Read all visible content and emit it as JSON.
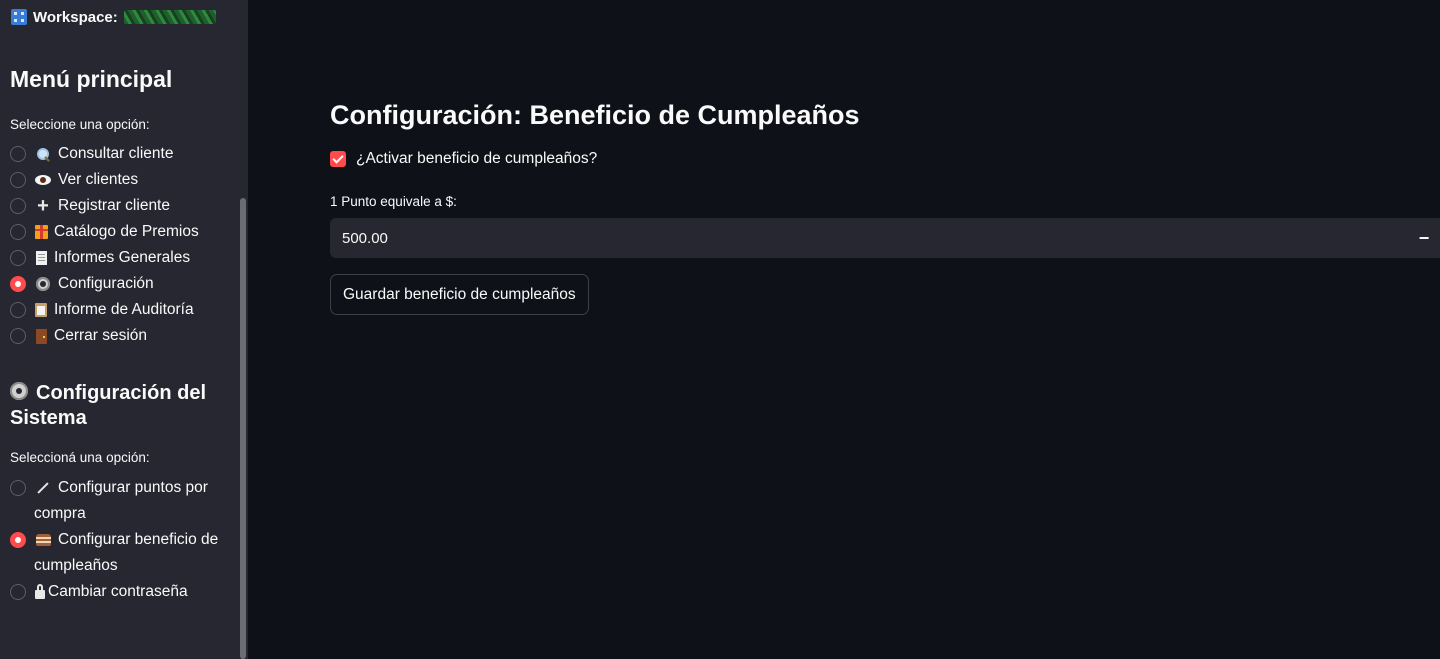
{
  "sidebar": {
    "workspace_label": "Workspace:",
    "main_menu": {
      "title": "Menú principal",
      "caption": "Seleccione una opción:",
      "items": [
        {
          "icon": "magnifier-icon",
          "label": "Consultar cliente",
          "selected": false
        },
        {
          "icon": "eye-icon",
          "label": "Ver clientes",
          "selected": false
        },
        {
          "icon": "plus-icon",
          "label": "Registrar cliente",
          "selected": false
        },
        {
          "icon": "gift-icon",
          "label": "Catálogo de Premios",
          "selected": false
        },
        {
          "icon": "document-icon",
          "label": "Informes Generales",
          "selected": false
        },
        {
          "icon": "gear-icon",
          "label": "Configuración",
          "selected": true
        },
        {
          "icon": "clipboard-icon",
          "label": "Informe de Auditoría",
          "selected": false
        },
        {
          "icon": "door-icon",
          "label": "Cerrar sesión",
          "selected": false
        }
      ]
    },
    "system_config": {
      "title": "Configuración del Sistema",
      "caption": "Seleccioná una opción:",
      "items": [
        {
          "icon": "wand-icon",
          "label": "Configurar puntos por compra",
          "selected": false
        },
        {
          "icon": "cake-icon",
          "label": "Configurar beneficio de cumpleaños",
          "selected": true
        },
        {
          "icon": "lock-icon",
          "label": "Cambiar contraseña",
          "selected": false
        }
      ]
    }
  },
  "main": {
    "title": "Configuración: Beneficio de Cumpleaños",
    "checkbox_label": "¿Activar beneficio de cumpleaños?",
    "checkbox_checked": true,
    "field_label": "1 Punto equivale a $:",
    "field_value": "500.00",
    "minus_label": "−",
    "save_button_label": "Guardar beneficio de cumpleaños"
  },
  "colors": {
    "background": "#0e1117",
    "sidebar": "#262730",
    "accent": "#ff4b4b",
    "text": "#fafafa"
  }
}
